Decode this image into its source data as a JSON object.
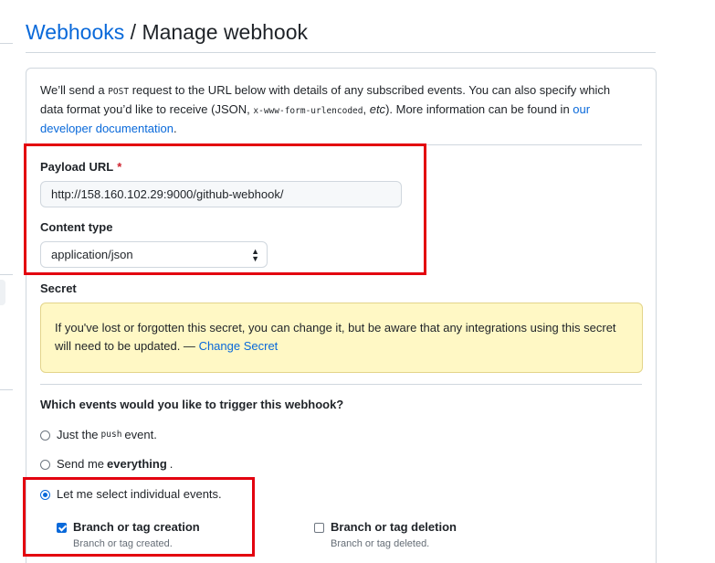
{
  "breadcrumb": {
    "parent": "Webhooks",
    "separator": "/",
    "current": "Manage webhook"
  },
  "intro": {
    "part1": "We’ll send a ",
    "post": "POST",
    "part2": " request to the URL below with details of any subscribed events. You can also specify which data format you’d like to receive (JSON, ",
    "form_encoded": "x-www-form-urlencoded",
    "part3": ", ",
    "etc": "etc",
    "part4": "). More information can be found in ",
    "link": "our developer documentation",
    "part5": "."
  },
  "payload_url": {
    "label": "Payload URL",
    "required_mark": "*",
    "value": "http://158.160.102.29:9000/github-webhook/"
  },
  "content_type": {
    "label": "Content type",
    "value": "application/json",
    "arrows": "▲▼"
  },
  "secret": {
    "label": "Secret",
    "notice": "If you've lost or forgotten this secret, you can change it, but be aware that any integrations using this secret will need to be updated. — ",
    "link": "Change Secret"
  },
  "events": {
    "question": "Which events would you like to trigger this webhook?",
    "opt_push_pre": "Just the",
    "opt_push_code": "push",
    "opt_push_post": "event.",
    "opt_all_pre": "Send me",
    "opt_all_bold": "everything",
    "opt_all_post": ".",
    "opt_individual": "Let me select individual events."
  },
  "individual_events": [
    {
      "label": "Branch or tag creation",
      "description": "Branch or tag created.",
      "checked": true
    },
    {
      "label": "Branch or tag deletion",
      "description": "Branch or tag deleted.",
      "checked": false
    }
  ],
  "colors": {
    "accent": "#0969da",
    "highlight": "#e3000f",
    "flash_bg": "#fff8c5"
  }
}
